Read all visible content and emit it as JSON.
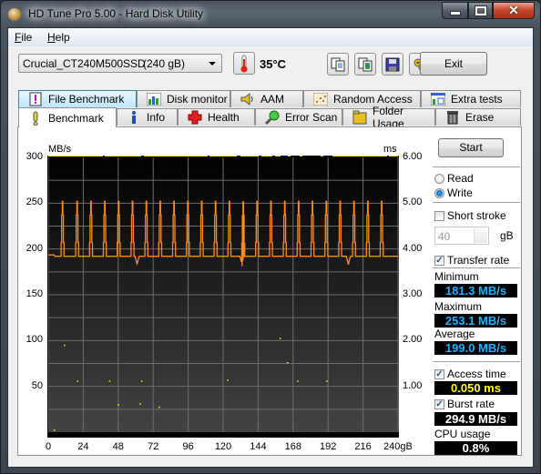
{
  "window": {
    "title": "HD Tune Pro 5.00 - Hard Disk Utility",
    "controls": [
      "minimize",
      "maximize",
      "close"
    ]
  },
  "menu": {
    "items": [
      {
        "label": "File",
        "accel": "F"
      },
      {
        "label": "Help",
        "accel": "H"
      }
    ]
  },
  "toolbar": {
    "drive_name": "Crucial_CT240M500SSD",
    "drive_size": "(240 gB)",
    "temperature": "35°C",
    "buttons": [
      "copy-text-icon",
      "copy-screenshot-icon",
      "save-icon",
      "options-icon",
      "download-icon"
    ],
    "exit_label": "Exit"
  },
  "tabs": {
    "row1": [
      {
        "label": "File Benchmark",
        "icon": "file-benchmark-icon"
      },
      {
        "label": "Disk monitor",
        "icon": "disk-monitor-icon"
      },
      {
        "label": "AAM",
        "icon": "speaker-icon"
      },
      {
        "label": "Random Access",
        "icon": "random-access-icon"
      },
      {
        "label": "Extra tests",
        "icon": "extra-tests-icon"
      }
    ],
    "row2": [
      {
        "label": "Benchmark",
        "icon": "exclamation-icon",
        "active": true
      },
      {
        "label": "Info",
        "icon": "info-icon"
      },
      {
        "label": "Health",
        "icon": "health-cross-icon"
      },
      {
        "label": "Error Scan",
        "icon": "magnifier-icon"
      },
      {
        "label": "Folder Usage",
        "icon": "folder-icon"
      },
      {
        "label": "Erase",
        "icon": "trash-icon"
      }
    ]
  },
  "benchmark": {
    "start_label": "Start",
    "mode": {
      "options": [
        "Read",
        "Write"
      ],
      "selected": "Write"
    },
    "short_stroke": {
      "label": "Short stroke",
      "checked": false,
      "value": "40",
      "unit": "gB"
    },
    "transfer_rate": {
      "label": "Transfer rate",
      "checked": true
    },
    "minimum": {
      "label": "Minimum",
      "value": "181.3 MB/s"
    },
    "maximum": {
      "label": "Maximum",
      "value": "253.1 MB/s"
    },
    "average": {
      "label": "Average",
      "value": "199.0 MB/s"
    },
    "access_time": {
      "label": "Access time",
      "checked": true,
      "value": "0.050 ms"
    },
    "burst_rate": {
      "label": "Burst rate",
      "checked": true,
      "value": "294.9 MB/s"
    },
    "cpu_usage": {
      "label": "CPU usage",
      "value": "0.8%"
    }
  },
  "colors": {
    "transfer_line": "#ff8c1a",
    "access_dots": "#ffff00",
    "readout_blue": "#1ab2ff",
    "readout_yellow": "#ffff00",
    "readout_white": "#ffffff"
  },
  "chart_data": {
    "type": "line",
    "title": "",
    "ylabel_left": "MB/s",
    "ylabel_right": "ms",
    "xlabel": "gB",
    "xlim": [
      0,
      240
    ],
    "ylim_left": [
      0,
      300
    ],
    "ylim_right": [
      0,
      6
    ],
    "x_ticks": [
      "0",
      "24",
      "48",
      "72",
      "96",
      "120",
      "144",
      "168",
      "192",
      "216",
      "240gB"
    ],
    "y_ticks_left": [
      "50",
      "100",
      "150",
      "200",
      "250",
      "300"
    ],
    "y_ticks_right": [
      "1.00",
      "2.00",
      "3.00",
      "4.00",
      "5.00",
      "6.00"
    ],
    "grid": true,
    "series": [
      {
        "name": "Transfer rate",
        "axis": "left",
        "baseline": 192,
        "spike_positions_gB": [
          10,
          20,
          29.5,
          39,
          48.5,
          58,
          67.5,
          77,
          86.5,
          96,
          105.5,
          115,
          124.5,
          134,
          143.5,
          153,
          162.5,
          172,
          181.5,
          191,
          200.5,
          210,
          219.5,
          229
        ],
        "spike_peak": 252,
        "dips": [
          {
            "x": 61,
            "min": 184
          },
          {
            "x": 133,
            "min": 181.3
          },
          {
            "x": 206,
            "min": 183
          }
        ]
      },
      {
        "name": "Access time",
        "axis": "right",
        "type": "scatter",
        "points": [
          [
            4,
            0.05
          ],
          [
            11,
            1.9
          ],
          [
            20,
            1.12
          ],
          [
            42,
            1.12
          ],
          [
            48,
            0.6
          ],
          [
            63,
            0.62
          ],
          [
            64,
            1.12
          ],
          [
            76,
            0.55
          ],
          [
            123,
            1.14
          ],
          [
            159,
            2.05
          ],
          [
            164,
            1.52
          ],
          [
            171,
            1.12
          ],
          [
            191,
            1.12
          ]
        ],
        "baseline_ms": 0.05
      }
    ]
  }
}
